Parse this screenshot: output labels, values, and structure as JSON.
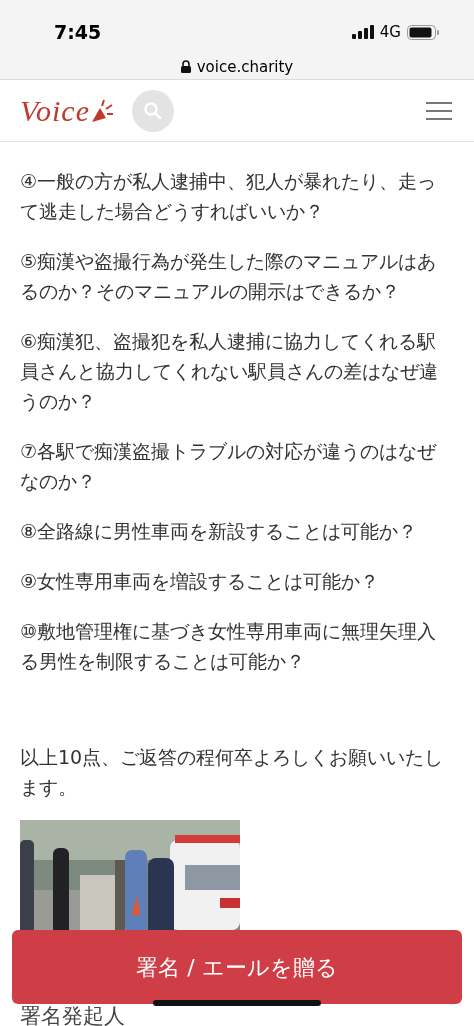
{
  "status_bar": {
    "time": "7:45",
    "network": "4G"
  },
  "address_bar": {
    "url": "voice.charity"
  },
  "header": {
    "logo": "Voice"
  },
  "questions": [
    "④一般の方が私人逮捕中、犯人が暴れたり、走って逃走した場合どうすればいいか？",
    "⑤痴漢や盗撮行為が発生した際のマニュアルはあるのか？そのマニュアルの開示はできるか？",
    "⑥痴漢犯、盗撮犯を私人逮捕に協力してくれる駅員さんと協力してくれない駅員さんの差はなぜ違うのか？",
    "⑦各駅で痴漢盗撮トラブルの対応が違うのはなぜなのか？",
    "⑧全路線に男性車両を新設することは可能か？",
    "⑨女性専用車両を増設することは可能か？",
    "⑩敷地管理権に基づき女性専用車両に無理矢理入る男性を制限することは可能か？"
  ],
  "closing": "以上10点、ご返答の程何卒よろしくお願いいたします。",
  "section_heading": "署名発起人",
  "action_button": "署名 / エールを贈る"
}
